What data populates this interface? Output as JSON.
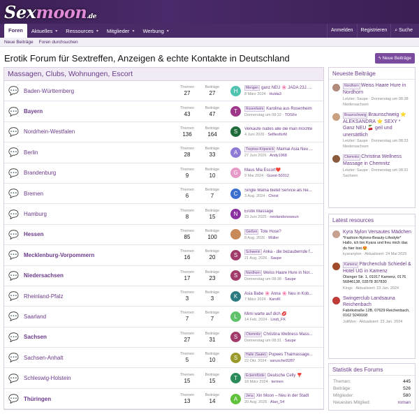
{
  "brand": {
    "part1": "Sex",
    "part2": "moon",
    "tld": ".de"
  },
  "nav": {
    "tabs": [
      {
        "label": "Foren"
      },
      {
        "label": "Aktuelles"
      },
      {
        "label": "Ressources"
      },
      {
        "label": "Mitglieder"
      },
      {
        "label": "Werbung"
      }
    ],
    "login": "Anmelden",
    "register": "Registrieren",
    "search": "Suche"
  },
  "subnav": {
    "new_posts": "Neue Beiträge",
    "search_forums": "Foren durchsuchen"
  },
  "page": {
    "title": "Erotik Forum für Sextreffen, Anzeigen & echte Kontakte in Deutschland",
    "new_posts_button": "Neue Beiträge"
  },
  "section": {
    "title": "Massagen, Clubs, Wohnungen, Escort",
    "threads_label": "Themen",
    "posts_label": "Beiträge"
  },
  "forums": [
    {
      "name": "Baden-Württemberg",
      "bold": false,
      "threads": "27",
      "posts": "27",
      "avatar": "H",
      "avcolor": "#4fc2b0",
      "prefix": "Mengen",
      "title": "ganz NEU 🌸 JADA 23J. ...",
      "date": "8 März 2024",
      "user": "Hulda3"
    },
    {
      "name": "Bayern",
      "bold": true,
      "threads": "43",
      "posts": "47",
      "avatar": "T",
      "avcolor": "#a0368a",
      "prefix": "Rosenheim",
      "title": "Karolina aus Rosenheim",
      "date": "Donnerstag um 08:32",
      "user": "TDSFe"
    },
    {
      "name": "Nordrhein-Westfalen",
      "bold": false,
      "threads": "136",
      "posts": "164",
      "avatar": "S",
      "avcolor": "#1f6b3a",
      "prefix": "",
      "title": "Verkaufe nudes alle die man möchte",
      "date": "4 Juni 2026",
      "user": "SelfiesfürM"
    },
    {
      "name": "Berlin",
      "bold": false,
      "threads": "28",
      "posts": "33",
      "avatar": "A",
      "avcolor": "#8f7ad6",
      "prefix": "Treptow-Köpenick",
      "title": "Maimai Asia Neu ...",
      "date": "27 Juni 2026",
      "user": "Andy1968"
    },
    {
      "name": "Brandenburg",
      "bold": false,
      "threads": "9",
      "posts": "10",
      "avatar": "G",
      "avcolor": "#e79ac8",
      "prefix": "",
      "title": "Maus Mia Escort❤️",
      "date": "9 Mai 2024",
      "user": "Guest-50312"
    },
    {
      "name": "Bremen",
      "bold": false,
      "threads": "6",
      "posts": "7",
      "avatar": "C",
      "avcolor": "#3a6fd0",
      "prefix": "",
      "title": "Single Mama bietet Service als Ne...",
      "date": "3 Aug. 2024",
      "user": "Christ"
    },
    {
      "name": "Hamburg",
      "bold": false,
      "threads": "8",
      "posts": "15",
      "avatar": "N",
      "avcolor": "#8a2f9f",
      "prefix": "",
      "title": "Erotik Massage",
      "date": "23 Juni 2025",
      "user": "neolandsnowsun"
    },
    {
      "name": "Hessen",
      "bold": true,
      "threads": "85",
      "posts": "100",
      "avatar": "",
      "avcolor": "#c98a5a",
      "prefix": "Gießen",
      "title": "Tote Hose?",
      "date": "8 Aug. 2026",
      "user": "Müller"
    },
    {
      "name": "Mecklenburg-Vorpommern",
      "bold": true,
      "threads": "16",
      "posts": "20",
      "avatar": "S",
      "avcolor": "#a03a6a",
      "prefix": "Schwerin",
      "title": "Anka - die bezaubernde f...",
      "date": "21 Aug. 2026",
      "user": "Saupe"
    },
    {
      "name": "Niedersachsen",
      "bold": true,
      "threads": "17",
      "posts": "23",
      "avatar": "S",
      "avcolor": "#a03a6a",
      "prefix": "Nordhorn",
      "title": "Weiss Haare Hure in Nor...",
      "date": "Donnerstag um 08:38",
      "user": "Saupe"
    },
    {
      "name": "Rheinland-Pfalz",
      "bold": false,
      "threads": "3",
      "posts": "3",
      "avatar": "K",
      "avcolor": "#2a7a80",
      "prefix": "",
      "title": "Asia Babe 🌸 Anna 🌸 Neu in Kob...",
      "date": "7 März 2024",
      "user": "KarolK"
    },
    {
      "name": "Saarland",
      "bold": false,
      "threads": "7",
      "posts": "7",
      "avatar": "L",
      "avcolor": "#5fc26a",
      "prefix": "",
      "title": "Mimi warte auf dich 💋",
      "date": "14 Feb. 2024",
      "user": "Lindi_FK"
    },
    {
      "name": "Sachsen",
      "bold": true,
      "threads": "27",
      "posts": "31",
      "avatar": "S",
      "avcolor": "#a03a6a",
      "prefix": "Chemnitz",
      "title": "Christina Wellness Mass...",
      "date": "Donnerstag um 08:31",
      "user": "Saupe"
    },
    {
      "name": "Sachsen-Anhalt",
      "bold": false,
      "threads": "5",
      "posts": "10",
      "avatar": "S",
      "avcolor": "#9a9a2a",
      "prefix": "Halle (Saale)",
      "title": "Pupees Thaimassage...",
      "date": "22 Okt. 2024",
      "user": "saruschel3287"
    },
    {
      "name": "Schleswig-Holstein",
      "bold": false,
      "threads": "15",
      "posts": "15",
      "avatar": "T",
      "avcolor": "#2a8a5a",
      "prefix": "Eckernförde",
      "title": "Deutsche Celly ❣️",
      "date": "18 März 2024",
      "user": "termen"
    },
    {
      "name": "Thüringen",
      "bold": true,
      "threads": "13",
      "posts": "14",
      "avatar": "A",
      "avcolor": "#5fc23a",
      "prefix": "Jena",
      "title": "Xin Moon – Neu in der Stadt",
      "date": "20 Aug. 2026",
      "user": "Alan_54"
    }
  ],
  "recent": {
    "title": "Neueste Beiträge",
    "items": [
      {
        "prefix": "Nordhorn",
        "title": "Weiss Haare Hure in Nordhorn",
        "meta1": "Letzter: Saupe · Donnerstag um 08:38",
        "meta2": "Niedersachsen",
        "avcolor": "#b08a7a"
      },
      {
        "prefix": "Braunschweig",
        "title": "Braunschweig ⭐ ALEKSANDRA ⭐ SEXY * Ganz NEU 🍒 geil und unersättlich",
        "meta1": "Letzter: Saupe · Donnerstag um 08:33",
        "meta2": "Niedersachsen",
        "avcolor": "#c9a080"
      },
      {
        "prefix": "Chemnitz",
        "title": "Christina Wellness Massage in Chemnitz",
        "meta1": "Letzter: Saupe · Donnerstag um 08:31",
        "meta2": "Sachsen",
        "avcolor": "#8a5a3a"
      }
    ]
  },
  "resources": {
    "title": "Latest resources",
    "items": [
      {
        "prefix": "",
        "title": "Kyra Nylon Versautes Mädchen",
        "desc": "*Fashion-Nylons-Beauty-Lifestyle* Hallo, ich bin Kyara und freu mich das du hier bist.😍",
        "meta": "kyaranylon · Aktualisiert: 24 Mai 2025",
        "avcolor": "#c8a090"
      },
      {
        "prefix": "Kamenz",
        "title": "Pärchenclub Schiedel & Hotel UG in Kamenz",
        "desc": "Ölsinger Str. 1, 01917 Kamenz, 0176 56846138, 03578 307830",
        "meta": "Kings · Aktualisiert: 23 Jan. 2024",
        "avcolor": "#a04a2a"
      },
      {
        "prefix": "",
        "title": "Swingerclub Landsauna Reichenbach",
        "desc": "Fabrikstraße 12B, 07629 Reichenbach, 0162 9249168",
        "meta": "JuliMon · Aktualisiert: 23 Jan. 2024",
        "avcolor": "#c03a3a"
      }
    ]
  },
  "stats": {
    "title": "Statistik des Forums",
    "rows": [
      {
        "label": "Themen:",
        "value": "445"
      },
      {
        "label": "Beiträge:",
        "value": "526"
      },
      {
        "label": "Mitglieder:",
        "value": "580"
      },
      {
        "label": "Neuestes Mitglied:",
        "value": "roman"
      }
    ]
  }
}
